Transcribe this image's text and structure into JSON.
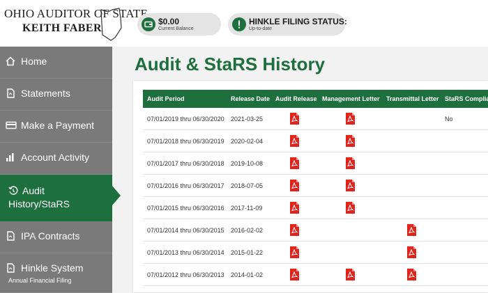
{
  "header": {
    "logo_line1": "OHIO AUDITOR OF STATE",
    "logo_line2": "KEITH FABER",
    "balance": {
      "amount": "$0.00",
      "label": "Current Balance"
    },
    "filing": {
      "title": "HINKLE FILING STATUS:",
      "status": "Up-to-date"
    }
  },
  "sidebar": {
    "items": [
      {
        "label": "Home",
        "icon": "home-icon"
      },
      {
        "label": "Statements",
        "icon": "document-icon"
      },
      {
        "label": "Make a Payment",
        "icon": "credit-card-icon"
      },
      {
        "label": "Account Activity",
        "icon": "bar-chart-icon"
      },
      {
        "label": "Audit History/StaRS",
        "icon": "history-icon",
        "active": true
      },
      {
        "label": "IPA Contracts",
        "icon": "document-icon"
      },
      {
        "label": "Hinkle System",
        "sublabel": "Annual Financial Filing",
        "icon": "document-icon"
      }
    ]
  },
  "main": {
    "title": "Audit & StaRS History",
    "table": {
      "headers": [
        "Audit Period",
        "Release Date",
        "Audit Release",
        "Management Letter",
        "Transmittal Letter",
        "StaRS Complian"
      ],
      "rows": [
        {
          "period": "07/01/2019 thru 06/30/2020",
          "release_date": "2021-03-25",
          "audit_release": true,
          "management_letter": true,
          "transmittal_letter": false,
          "stars": "No"
        },
        {
          "period": "07/01/2018 thru 06/30/2019",
          "release_date": "2020-02-04",
          "audit_release": true,
          "management_letter": true,
          "transmittal_letter": false,
          "stars": ""
        },
        {
          "period": "07/01/2017 thru 06/30/2018",
          "release_date": "2019-10-08",
          "audit_release": true,
          "management_letter": true,
          "transmittal_letter": false,
          "stars": ""
        },
        {
          "period": "07/01/2016 thru 06/30/2017",
          "release_date": "2018-07-05",
          "audit_release": true,
          "management_letter": true,
          "transmittal_letter": false,
          "stars": ""
        },
        {
          "period": "07/01/2015 thru 06/30/2016",
          "release_date": "2017-11-09",
          "audit_release": true,
          "management_letter": true,
          "transmittal_letter": false,
          "stars": ""
        },
        {
          "period": "07/01/2014 thru 06/30/2015",
          "release_date": "2016-02-02",
          "audit_release": true,
          "management_letter": false,
          "transmittal_letter": true,
          "stars": ""
        },
        {
          "period": "07/01/2013 thru 06/30/2014",
          "release_date": "2015-01-22",
          "audit_release": true,
          "management_letter": false,
          "transmittal_letter": true,
          "stars": ""
        },
        {
          "period": "07/01/2012 thru 06/30/2013",
          "release_date": "2014-01-02",
          "audit_release": true,
          "management_letter": true,
          "transmittal_letter": true,
          "stars": ""
        }
      ]
    }
  },
  "colors": {
    "brand_green": "#1e6f3e",
    "sidebar_gray": "#7a7a7a",
    "pdf_red": "#e2231a"
  }
}
